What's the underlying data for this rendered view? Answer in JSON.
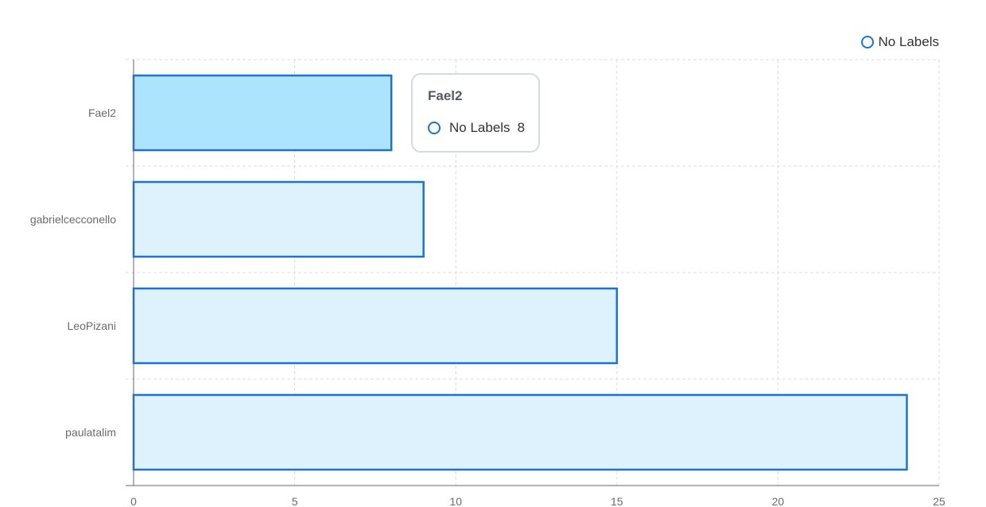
{
  "chart_data": {
    "type": "bar",
    "orientation": "horizontal",
    "categories": [
      "Fael2",
      "gabrielcecconello",
      "LeoPizani",
      "paulatalim"
    ],
    "series": [
      {
        "name": "No Labels",
        "values": [
          8,
          9,
          15,
          24
        ]
      }
    ],
    "xlim": [
      0,
      25
    ],
    "x_ticks": [
      "0",
      "5",
      "10",
      "15",
      "20",
      "25"
    ],
    "grid": true,
    "legend_position": "top-right",
    "highlighted_category": "Fael2"
  },
  "tooltip": {
    "title": "Fael2",
    "series_name": "No Labels",
    "value": "8"
  },
  "colors": {
    "bar_fill": "#ddf2fd",
    "bar_fill_highlight": "#ade4fd",
    "bar_stroke": "#1a73d1",
    "grid": "#dddddd",
    "axis": "#666666",
    "tick_text": "#6b6b6b"
  }
}
